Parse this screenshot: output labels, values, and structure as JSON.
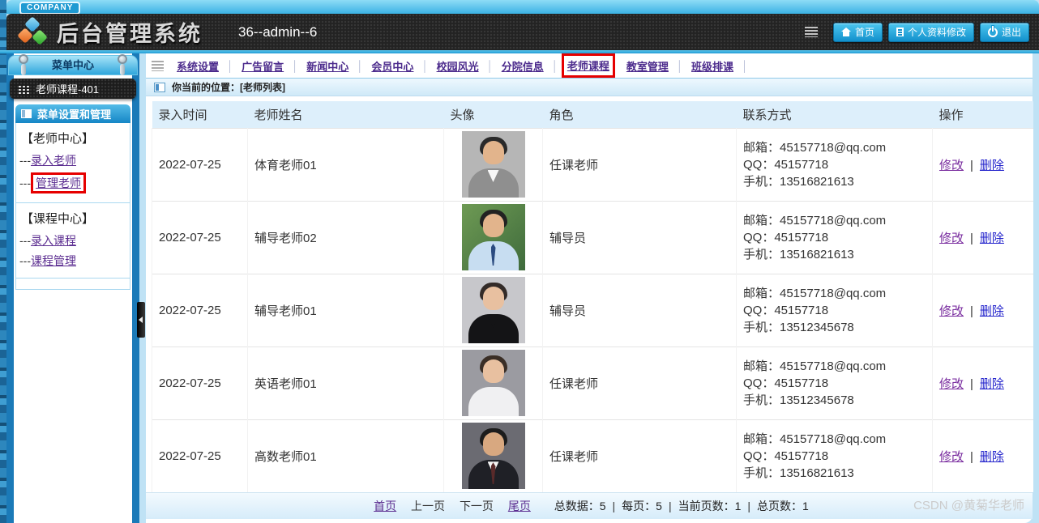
{
  "header": {
    "company_badge": "COMPANY",
    "title": "后台管理系统",
    "subtitle": "36--admin--6",
    "buttons": {
      "home": "首页",
      "profile": "个人资料修改",
      "logout": "退出"
    }
  },
  "nav": {
    "separator": "│",
    "items": [
      {
        "label": "系统设置"
      },
      {
        "label": "广告留言"
      },
      {
        "label": "新闻中心"
      },
      {
        "label": "会员中心"
      },
      {
        "label": "校园风光"
      },
      {
        "label": "分院信息"
      },
      {
        "label": "老师课程",
        "highlighted": true
      },
      {
        "label": "教室管理"
      },
      {
        "label": "班级排课"
      }
    ]
  },
  "sidebar": {
    "menu_center_title": "菜单中心",
    "current_module": "老师课程-401",
    "menu_manage_title": "菜单设置和管理",
    "groups": [
      {
        "title": "【老师中心】",
        "links": [
          {
            "prefix": "---",
            "label": "录入老师",
            "highlighted": false
          },
          {
            "prefix": "---",
            "label": "管理老师",
            "highlighted": true
          }
        ]
      },
      {
        "title": "【课程中心】",
        "links": [
          {
            "prefix": "---",
            "label": "录入课程",
            "highlighted": false
          },
          {
            "prefix": "---",
            "label": "课程管理",
            "highlighted": false
          }
        ]
      }
    ]
  },
  "breadcrumb": {
    "label": "你当前的位置：[老师列表]"
  },
  "table": {
    "columns": [
      "录入时间",
      "老师姓名",
      "头像",
      "角色",
      "联系方式",
      "操作"
    ],
    "actions": {
      "edit": "修改",
      "separator": "|",
      "delete": "删除"
    },
    "rows": [
      {
        "date": "2022-07-25",
        "name": "体育老师01",
        "avatar": "man-gray-suit-glasses-portrait",
        "role": "任课老师",
        "email": "邮箱：45157718@qq.com",
        "qq": "QQ：45157718",
        "phone": "手机：13516821613"
      },
      {
        "date": "2022-07-25",
        "name": "辅导老师02",
        "avatar": "man-blue-shirt-tie-green-background-portrait",
        "role": "辅导员",
        "email": "邮箱：45157718@qq.com",
        "qq": "QQ：45157718",
        "phone": "手机：13516821613"
      },
      {
        "date": "2022-07-25",
        "name": "辅导老师01",
        "avatar": "woman-black-top-gray-background-portrait",
        "role": "辅导员",
        "email": "邮箱：45157718@qq.com",
        "qq": "QQ：45157718",
        "phone": "手机：13512345678"
      },
      {
        "date": "2022-07-25",
        "name": "英语老师01",
        "avatar": "woman-white-blouse-portrait",
        "role": "任课老师",
        "email": "邮箱：45157718@qq.com",
        "qq": "QQ：45157718",
        "phone": "手机：13512345678"
      },
      {
        "date": "2022-07-25",
        "name": "高数老师01",
        "avatar": "man-dark-suit-glasses-portrait",
        "role": "任课老师",
        "email": "邮箱：45157718@qq.com",
        "qq": "QQ：45157718",
        "phone": "手机：13516821613"
      }
    ]
  },
  "pagination": {
    "first": "首页",
    "prev": "上一页",
    "next": "下一页",
    "last": "尾页",
    "stats_separator": "|",
    "stats": [
      "总数据：5",
      "每页：5",
      "当前页数：1",
      "总页数：1"
    ]
  },
  "watermark": "CSDN @黄菊华老师",
  "colors": {
    "frame_cyan": "#3fb6e8",
    "frame_light": "#bfe2f5",
    "header_dark": "#232323",
    "button_cyan": "#1290cc",
    "link_purple": "#5b2d90",
    "edit_purple": "#7b2fa0",
    "delete_blue": "#2525cc",
    "highlight_red": "#e60000",
    "table_header_bg": "#ddeffb",
    "sidebar_blue": "#1b7ab8"
  }
}
